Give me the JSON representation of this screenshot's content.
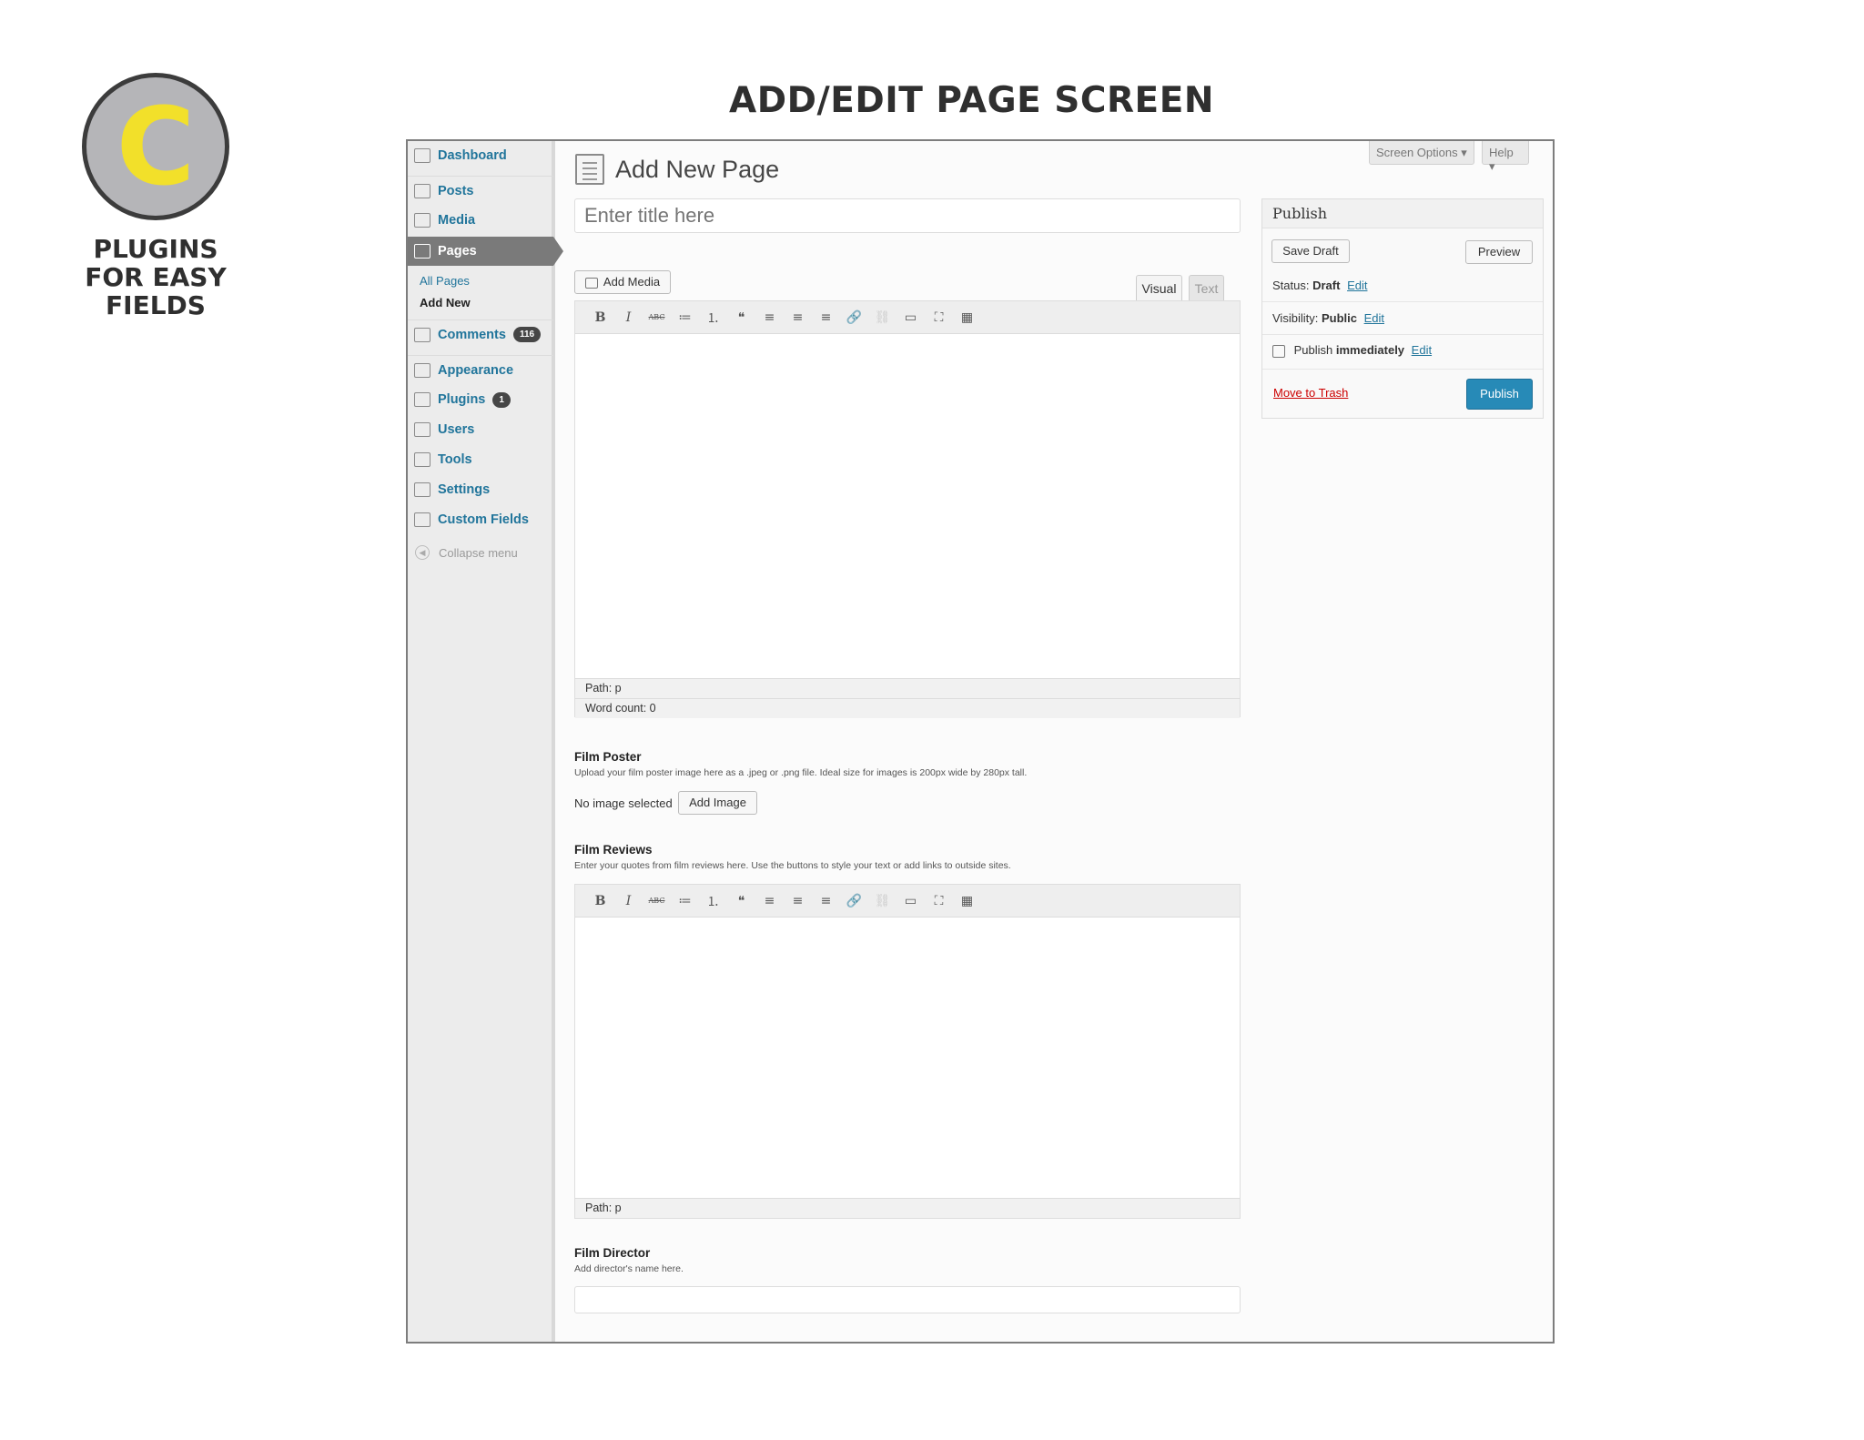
{
  "badge": {
    "letter": "C",
    "caption": [
      "PLUGINS",
      "FOR EASY",
      "FIELDS"
    ]
  },
  "doc_title": "ADD/EDIT PAGE SCREEN",
  "sidebar": {
    "items": [
      {
        "label": "Dashboard",
        "icon": "dashboard-icon"
      },
      {
        "label": "Posts",
        "icon": "pin-icon"
      },
      {
        "label": "Media",
        "icon": "media-icon"
      },
      {
        "label": "Pages",
        "icon": "pages-icon",
        "active": true
      },
      {
        "label": "Comments",
        "icon": "comment-icon",
        "count": "116"
      },
      {
        "label": "Appearance",
        "icon": "appearance-icon"
      },
      {
        "label": "Plugins",
        "icon": "plugin-icon",
        "count": "1"
      },
      {
        "label": "Users",
        "icon": "users-icon"
      },
      {
        "label": "Tools",
        "icon": "tools-icon"
      },
      {
        "label": "Settings",
        "icon": "settings-icon"
      },
      {
        "label": "Custom Fields",
        "icon": "custom-fields-icon"
      }
    ],
    "submenu": [
      "All Pages",
      "Add New"
    ],
    "collapse": "Collapse menu"
  },
  "top": {
    "screen_options": "Screen Options ▾",
    "help": "Help ▾"
  },
  "main": {
    "heading": "Add New Page",
    "title_placeholder": "Enter title here",
    "add_media": "Add Media",
    "tabs": [
      "Visual",
      "Text"
    ],
    "toolbar": [
      "B",
      "I",
      "ABC",
      "≔",
      "⒈",
      "❝",
      "≡",
      "≡",
      "≡",
      "🔗",
      "⛓",
      "▭",
      "⛶",
      "▦"
    ],
    "path": "Path: p",
    "word_count": "Word count: 0"
  },
  "fields": {
    "poster": {
      "label": "Film Poster",
      "desc": "Upload your film poster image here as a .jpeg or .png file. Ideal size for images is 200px wide by 280px tall.",
      "no_image": "No image selected",
      "add_image": "Add Image"
    },
    "reviews": {
      "label": "Film Reviews",
      "desc": "Enter your quotes from film reviews here. Use the buttons to style your text or add links to outside sites.",
      "path": "Path: p"
    },
    "director": {
      "label": "Film Director",
      "desc": "Add director's name here."
    }
  },
  "publish": {
    "title": "Publish",
    "save_draft": "Save Draft",
    "preview": "Preview",
    "status_label": "Status:",
    "status_value": "Draft",
    "visibility_label": "Visibility:",
    "visibility_value": "Public",
    "publish_label": "Publish",
    "publish_value": "immediately",
    "edit": "Edit",
    "trash": "Move to Trash",
    "publish_button": "Publish"
  }
}
